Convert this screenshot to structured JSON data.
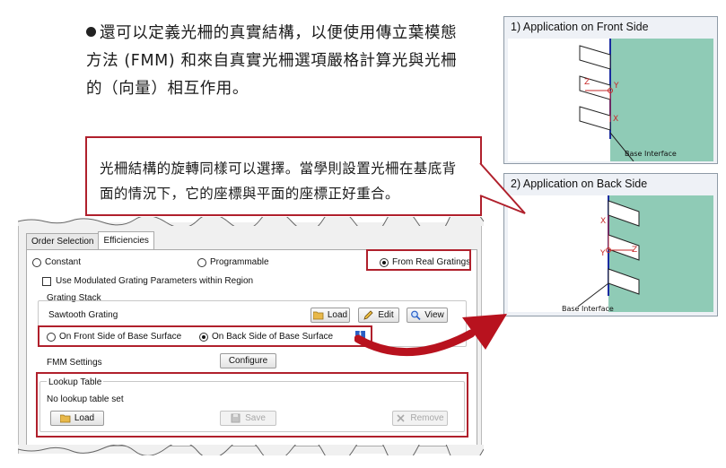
{
  "bullet_text": "還可以定義光柵的真實結構，以便使用傳立葉模態方法 (FMM) 和來自真實光柵選項嚴格計算光與光柵的（向量）相互作用。",
  "callout_text": "光柵結構的旋轉同樣可以選擇。當學則設置光柵在基底背面的情況下，它的座標與平面的座標正好重合。",
  "dialog": {
    "tabs": [
      "Order Selection",
      "Efficiencies"
    ],
    "active_tab": "Efficiencies",
    "mode_constant": "Constant",
    "mode_programmable": "Programmable",
    "mode_real": "From Real Gratings",
    "use_modulated": "Use Modulated Grating Parameters within Region",
    "grating_stack_label": "Grating Stack",
    "sawtooth_label": "Sawtooth Grating",
    "load_label": "Load",
    "edit_label": "Edit",
    "view_label": "View",
    "front_side": "On Front Side of Base Surface",
    "back_side": "On Back Side of Base Surface",
    "fmm_label": "FMM Settings",
    "configure_label": "Configure",
    "lookup_label": "Lookup Table",
    "no_lookup": "No lookup table set",
    "lookup_load": "Load",
    "save_label": "Save",
    "remove_label": "Remove"
  },
  "panels": {
    "front_title": "1) Application on Front Side",
    "back_title": "2) Application on Back Side",
    "base_interface": "Base Interface",
    "axis_x": "X",
    "axis_y": "Y",
    "axis_z": "Z"
  },
  "colors": {
    "accent_red": "#b0202c",
    "substrate": "#8fcbb6",
    "interface_line": "#1a2aa0"
  }
}
